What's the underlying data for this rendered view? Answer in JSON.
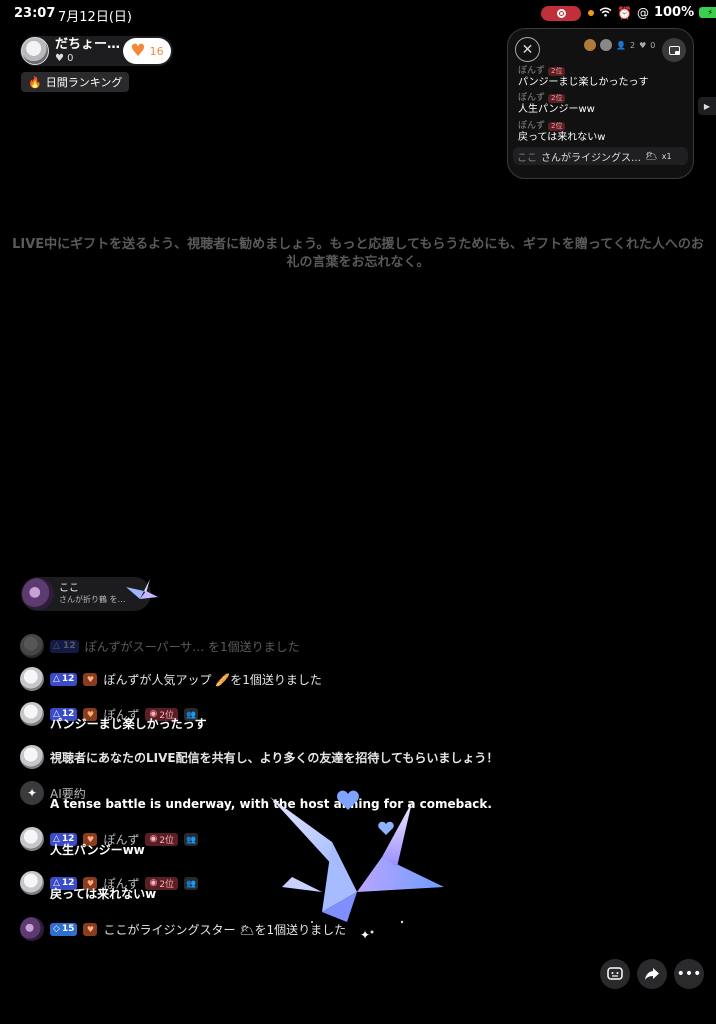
{
  "status_bar": {
    "time": "23:07",
    "date": "7月12日(日)",
    "battery": "100%"
  },
  "host": {
    "name": "だちょー…",
    "likes": "0",
    "like_button_count": "16",
    "ranking_label": "日間ランキング"
  },
  "float_card": {
    "close_icon": "close-icon",
    "stats": {
      "viewers": "2",
      "likes": "0"
    },
    "messages": [
      {
        "user": "ぽんず",
        "rank": "2位",
        "text": "パンジーまじ楽しかったっす"
      },
      {
        "user": "ぽんず",
        "rank": "2位",
        "text": "人生パンジーww"
      },
      {
        "user": "ぽんず",
        "rank": "2位",
        "text": "戻っては来れないw"
      }
    ],
    "gift_row": {
      "user": "ここ",
      "text": "さんがライジングス…",
      "count": "x1"
    }
  },
  "hint": "LIVE中にギフトを送るよう、視聴者に勧めましょう。もっと応援してもらうためにも、ギフトを贈ってくれた人へのお礼の言葉をお忘れなく。",
  "gift_notice": {
    "user": "ここ",
    "desc": "さんが折り鶴 を…"
  },
  "chat": {
    "partial_top": "ぽんずがスーパーサ… を1個送りました",
    "rows": [
      {
        "level": "12",
        "text": "ぽんずが人気アップ 🥖を1個送りました"
      },
      {
        "level": "12",
        "user": "ぽんず",
        "rank": "2位",
        "message": "パンジーまじ楽しかったっす"
      },
      {
        "system": "視聴者にあなたのLIVE配信を共有し、より多くの友達を招待してもらいましょう！"
      },
      {
        "ai_label": "AI要約",
        "ai_text": "A tense battle is underway, with the host aiming for a comeback."
      },
      {
        "level": "12",
        "user": "ぽんず",
        "rank": "2位",
        "message": "人生パンジーww"
      },
      {
        "level": "12",
        "user": "ぽんず",
        "rank": "2位",
        "message": "戻っては来れないw"
      },
      {
        "level": "15",
        "text": "ここがライジングスター 🌥を1個送りました"
      }
    ]
  },
  "actions": {
    "chat_icon": "chat-face-icon",
    "share_icon": "share-icon",
    "more_icon": "more-icon"
  },
  "colors": {
    "accent_orange": "#f4883a",
    "level_badge": "#3b4cc8",
    "rank_badge": "#5a1f25",
    "record": "#c0303a"
  }
}
